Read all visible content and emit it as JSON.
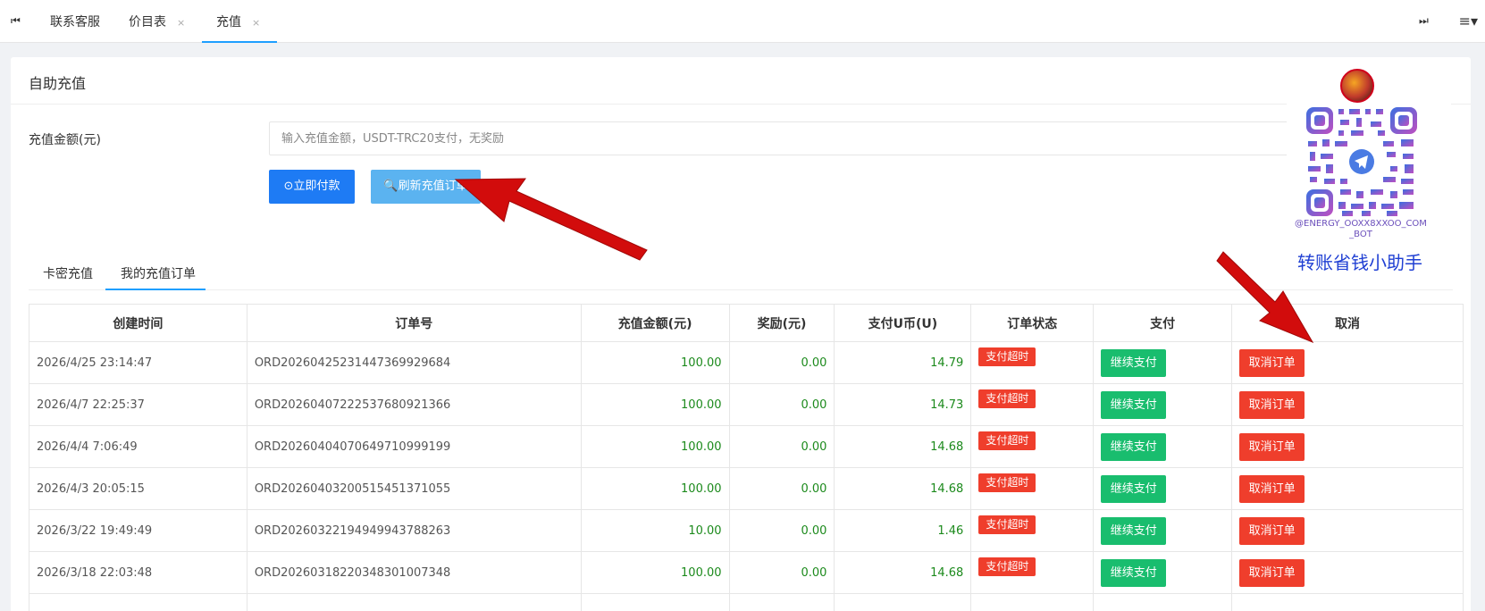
{
  "tabbar": {
    "prev_icon": "⏮",
    "next_icon": "⏭",
    "menu_icon": "≡▾",
    "tabs": [
      {
        "label": "联系客服",
        "closable": false
      },
      {
        "label": "价目表",
        "closable": true
      },
      {
        "label": "充值",
        "closable": true,
        "active": true
      }
    ],
    "close_glyph": "×"
  },
  "card": {
    "title": "自助充值",
    "amount_label": "充值金额(元)",
    "amount_placeholder": "输入充值金额，USDT-TRC20支付，无奖励",
    "pay_button": "⊙立即付款",
    "refresh_button": "🔍刷新充值订单"
  },
  "subtabs": [
    "卡密充值",
    "我的充值订单"
  ],
  "table": {
    "headers": [
      "创建时间",
      "订单号",
      "充值金额(元)",
      "奖励(元)",
      "支付U币(U)",
      "订单状态",
      "支付",
      "取消"
    ],
    "rows": [
      {
        "time": "2026/4/25 23:14:47",
        "order": "ORD20260425231447369929684",
        "amount": "100.00",
        "reward": "0.00",
        "usdt": "14.79",
        "status": "支付超时",
        "pay": "继续支付",
        "cancel": "取消订单"
      },
      {
        "time": "2026/4/7 22:25:37",
        "order": "ORD20260407222537680921366",
        "amount": "100.00",
        "reward": "0.00",
        "usdt": "14.73",
        "status": "支付超时",
        "pay": "继续支付",
        "cancel": "取消订单"
      },
      {
        "time": "2026/4/4 7:06:49",
        "order": "ORD20260404070649710999199",
        "amount": "100.00",
        "reward": "0.00",
        "usdt": "14.68",
        "status": "支付超时",
        "pay": "继续支付",
        "cancel": "取消订单"
      },
      {
        "time": "2026/4/3 20:05:15",
        "order": "ORD20260403200515451371055",
        "amount": "100.00",
        "reward": "0.00",
        "usdt": "14.68",
        "status": "支付超时",
        "pay": "继续支付",
        "cancel": "取消订单"
      },
      {
        "time": "2026/3/22 19:49:49",
        "order": "ORD20260322194949943788263",
        "amount": "10.00",
        "reward": "0.00",
        "usdt": "1.46",
        "status": "支付超时",
        "pay": "继续支付",
        "cancel": "取消订单"
      },
      {
        "time": "2026/3/18 22:03:48",
        "order": "ORD20260318220348301007348",
        "amount": "100.00",
        "reward": "0.00",
        "usdt": "14.68",
        "status": "支付超时",
        "pay": "继续支付",
        "cancel": "取消订单"
      }
    ]
  },
  "promo": {
    "handle": "@ENERGY_OOXX8XXOO_COM_BOT",
    "text": "转账省钱小助手"
  },
  "colors": {
    "accent": "#1e9fff",
    "pay_button": "#1e7bf4",
    "refresh_button": "#5bb3f0",
    "success": "#19bd6e",
    "danger": "#ef3e2c",
    "amount_text": "#1c8a1c",
    "arrow": "#d20c0c"
  }
}
